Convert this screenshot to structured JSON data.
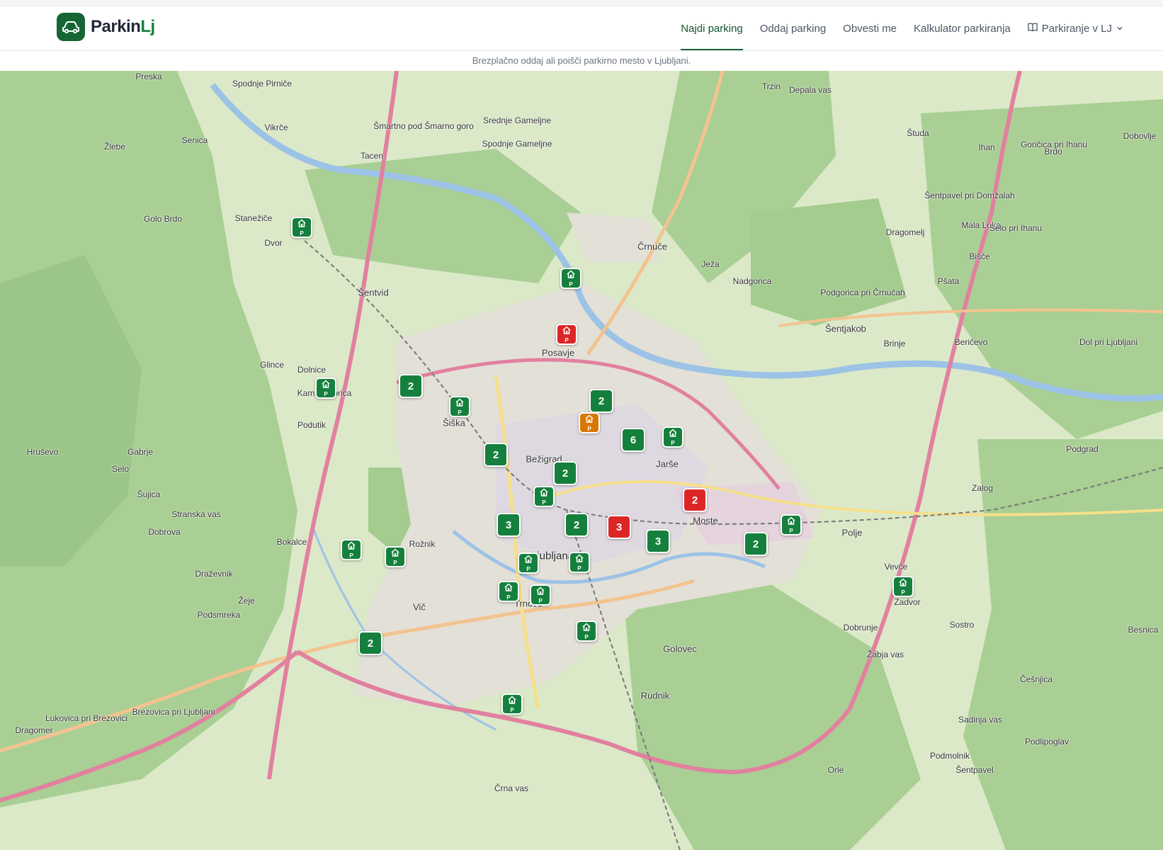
{
  "brand": {
    "name_main": "Parkin",
    "name_accent": "Lj"
  },
  "nav": {
    "items": [
      "Najdi parking",
      "Oddaj parking",
      "Obvesti me",
      "Kalkulator parkiranja"
    ],
    "dropdown_label": "Parkiranje v LJ"
  },
  "tagline": "Brezplačno oddaj ali poišči parkirno mesto v Ljubljani.",
  "colors": {
    "accent": "#166534",
    "spot_available": "#15803d",
    "spot_busy": "#dc2626",
    "spot_pending": "#d97706"
  },
  "map_places": [
    "Preska",
    "Spodnje Pirniče",
    "Vikrče",
    "Tacen",
    "Šmartno pod Šmarno goro",
    "Srednje Gameljne",
    "Spodnje Gameljne",
    "Stanežiče",
    "Dvor",
    "Šentvid",
    "Glince",
    "Dolnice",
    "Kamna Gorica",
    "Podutik",
    "Šiška",
    "Posavje",
    "Bežigrad",
    "Jarše",
    "Moste",
    "Ljubljana",
    "Trnovo",
    "Vič",
    "Bokalce",
    "Rožnik",
    "Golovec",
    "Rudnik",
    "Polje",
    "Vevče",
    "Zalog",
    "Zadvor",
    "Sostro",
    "Dobrunje",
    "Žabja vas",
    "Črnuče",
    "Ježa",
    "Nadgorica",
    "Podgorica pri Črnučah",
    "Šentjakob",
    "Brinje",
    "Beričevo",
    "Dol pri Ljubljani",
    "Ihan",
    "Študa",
    "Dragomelj",
    "Pšata",
    "Brdo",
    "Dobovlje",
    "Dobrova",
    "Šujica",
    "Selo",
    "Hruševo",
    "Gabrje",
    "Stranska vas",
    "Draževnik",
    "Žeje",
    "Podsmreka",
    "Brezovica pri Ljubljani",
    "Lukovica pri Brezovici",
    "Dragomer",
    "Črna vas",
    "Orle",
    "Podmolnik",
    "Sadinja vas",
    "Podlipoglav",
    "Šentpavel",
    "Besnica",
    "Češnjica",
    "Golo Brdo",
    "Senica",
    "Žlebe",
    "Trzin",
    "Depala vas",
    "Podgrad",
    "Mala Loka",
    "Selo pri Ihanu",
    "Bišče",
    "Šentpavel pri Domžalah",
    "Goričica pri Ihanu"
  ],
  "clusters": [
    {
      "count": "2",
      "status": "available"
    },
    {
      "count": "2",
      "status": "available"
    },
    {
      "count": "2",
      "status": "available"
    },
    {
      "count": "6",
      "status": "available"
    },
    {
      "count": "2",
      "status": "available"
    },
    {
      "count": "2",
      "status": "busy"
    },
    {
      "count": "3",
      "status": "available"
    },
    {
      "count": "2",
      "status": "available"
    },
    {
      "count": "3",
      "status": "busy"
    },
    {
      "count": "3",
      "status": "available"
    },
    {
      "count": "2",
      "status": "available"
    },
    {
      "count": "2",
      "status": "available"
    }
  ],
  "spots": [
    {
      "status": "available",
      "label": "P"
    },
    {
      "status": "available",
      "label": "P"
    },
    {
      "status": "busy",
      "label": "P"
    },
    {
      "status": "available",
      "label": "P"
    },
    {
      "status": "available",
      "label": "P"
    },
    {
      "status": "pending",
      "label": "P"
    },
    {
      "status": "available",
      "label": "P"
    },
    {
      "status": "available",
      "label": "P"
    },
    {
      "status": "available",
      "label": "P"
    },
    {
      "status": "available",
      "label": "P"
    },
    {
      "status": "available",
      "label": "P"
    },
    {
      "status": "available",
      "label": "P"
    },
    {
      "status": "available",
      "label": "P"
    },
    {
      "status": "available",
      "label": "P"
    },
    {
      "status": "available",
      "label": "P"
    },
    {
      "status": "available",
      "label": "P"
    },
    {
      "status": "available",
      "label": "P"
    },
    {
      "status": "available",
      "label": "P"
    }
  ]
}
